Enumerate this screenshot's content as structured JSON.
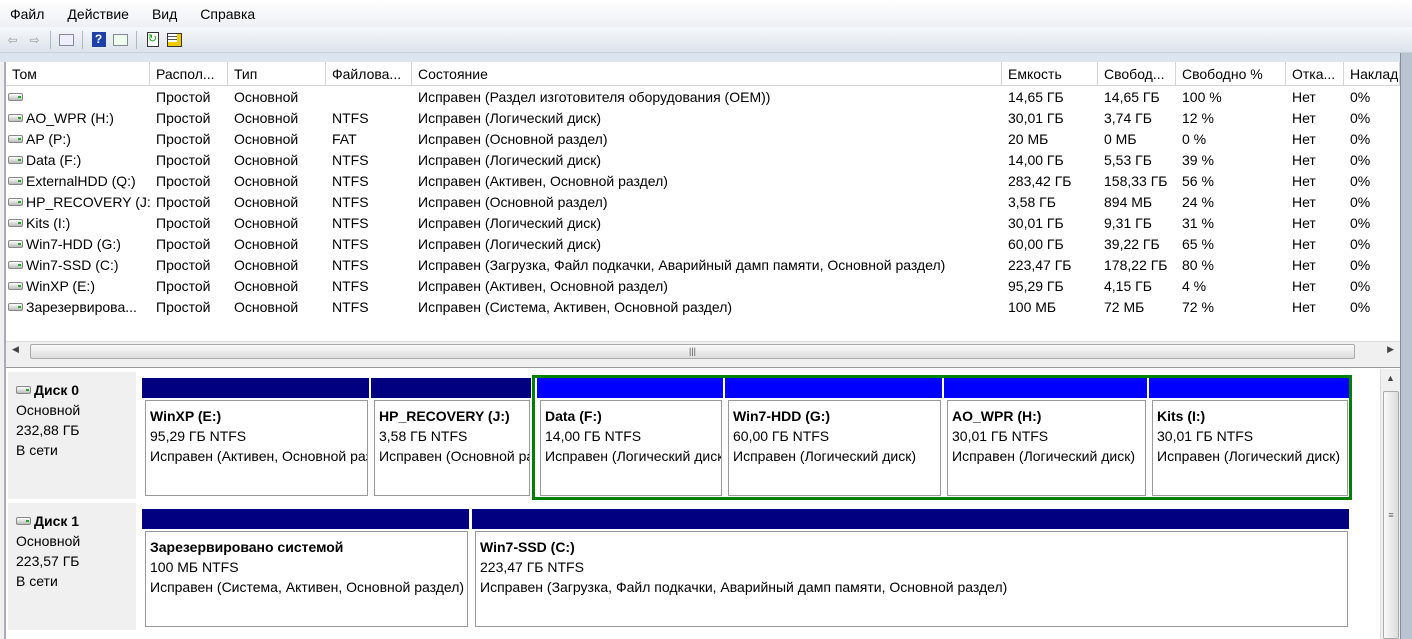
{
  "menu": [
    "Файл",
    "Действие",
    "Вид",
    "Справка"
  ],
  "toolbar": [
    "back-icon",
    "forward-icon",
    "show-hide-console-tree-icon",
    "help-icon",
    "show-hide-action-pane-icon",
    "refresh-icon",
    "properties-icon"
  ],
  "columns": [
    "Том",
    "Распол...",
    "Тип",
    "Файлова...",
    "Состояние",
    "Емкость",
    "Свобод...",
    "Свободно %",
    "Отка...",
    "Наклад"
  ],
  "volumes": [
    [
      "",
      "Простой",
      "Основной",
      "",
      "Исправен (Раздел изготовителя оборудования (OEM))",
      "14,65 ГБ",
      "14,65 ГБ",
      "100 %",
      "Нет",
      "0%"
    ],
    [
      "AO_WPR (H:)",
      "Простой",
      "Основной",
      "NTFS",
      "Исправен (Логический диск)",
      "30,01 ГБ",
      "3,74 ГБ",
      "12 %",
      "Нет",
      "0%"
    ],
    [
      "AP (P:)",
      "Простой",
      "Основной",
      "FAT",
      "Исправен (Основной раздел)",
      "20 МБ",
      "0 МБ",
      "0 %",
      "Нет",
      "0%"
    ],
    [
      "Data (F:)",
      "Простой",
      "Основной",
      "NTFS",
      "Исправен (Логический диск)",
      "14,00 ГБ",
      "5,53 ГБ",
      "39 %",
      "Нет",
      "0%"
    ],
    [
      "ExternalHDD (Q:)",
      "Простой",
      "Основной",
      "NTFS",
      "Исправен (Активен, Основной раздел)",
      "283,42 ГБ",
      "158,33 ГБ",
      "56 %",
      "Нет",
      "0%"
    ],
    [
      "HP_RECOVERY (J:)",
      "Простой",
      "Основной",
      "NTFS",
      "Исправен (Основной раздел)",
      "3,58 ГБ",
      "894 МБ",
      "24 %",
      "Нет",
      "0%"
    ],
    [
      "Kits (I:)",
      "Простой",
      "Основной",
      "NTFS",
      "Исправен (Логический диск)",
      "30,01 ГБ",
      "9,31 ГБ",
      "31 %",
      "Нет",
      "0%"
    ],
    [
      "Win7-HDD (G:)",
      "Простой",
      "Основной",
      "NTFS",
      "Исправен (Логический диск)",
      "60,00 ГБ",
      "39,22 ГБ",
      "65 %",
      "Нет",
      "0%"
    ],
    [
      "Win7-SSD (C:)",
      "Простой",
      "Основной",
      "NTFS",
      "Исправен (Загрузка, Файл подкачки, Аварийный дамп памяти, Основной раздел)",
      "223,47 ГБ",
      "178,22 ГБ",
      "80 %",
      "Нет",
      "0%"
    ],
    [
      "WinXP (E:)",
      "Простой",
      "Основной",
      "NTFS",
      "Исправен (Активен, Основной раздел)",
      "95,29 ГБ",
      "4,15 ГБ",
      "4 %",
      "Нет",
      "0%"
    ],
    [
      "Зарезервирова...",
      "Простой",
      "Основной",
      "NTFS",
      "Исправен (Система, Активен, Основной раздел)",
      "100 МБ",
      "72 МБ",
      "72 %",
      "Нет",
      "0%"
    ]
  ],
  "disks": [
    {
      "name": "Диск 0",
      "type": "Основной",
      "size": "232,88 ГБ",
      "status": "В сети",
      "partitions": [
        {
          "name": "WinXP  (E:)",
          "size": "95,29 ГБ NTFS",
          "status": "Исправен (Активен, Основной раздел)",
          "logical": false
        },
        {
          "name": "HP_RECOVERY  (J:)",
          "size": "3,58 ГБ NTFS",
          "status": "Исправен (Основной раздел)",
          "logical": false
        },
        {
          "name": "Data  (F:)",
          "size": "14,00 ГБ NTFS",
          "status": "Исправен (Логический диск)",
          "logical": true
        },
        {
          "name": "Win7-HDD  (G:)",
          "size": "60,00 ГБ NTFS",
          "status": "Исправен (Логический диск)",
          "logical": true
        },
        {
          "name": "AO_WPR  (H:)",
          "size": "30,01 ГБ NTFS",
          "status": "Исправен (Логический диск)",
          "logical": true
        },
        {
          "name": "Kits  (I:)",
          "size": "30,01 ГБ NTFS",
          "status": "Исправен (Логический диск)",
          "logical": true
        }
      ]
    },
    {
      "name": "Диск 1",
      "type": "Основной",
      "size": "223,57 ГБ",
      "status": "В сети",
      "partitions": [
        {
          "name": "Зарезервировано системой",
          "size": "100 МБ NTFS",
          "status": "Исправен (Система, Активен, Основной раздел)",
          "logical": false
        },
        {
          "name": "Win7-SSD  (C:)",
          "size": "223,47 ГБ NTFS",
          "status": "Исправен (Загрузка, Файл подкачки, Аварийный дамп памяти, Основной раздел)",
          "logical": false
        }
      ]
    }
  ],
  "colors": {
    "primary": "#000080",
    "logical": "#0000ff",
    "extended": "#008000"
  }
}
